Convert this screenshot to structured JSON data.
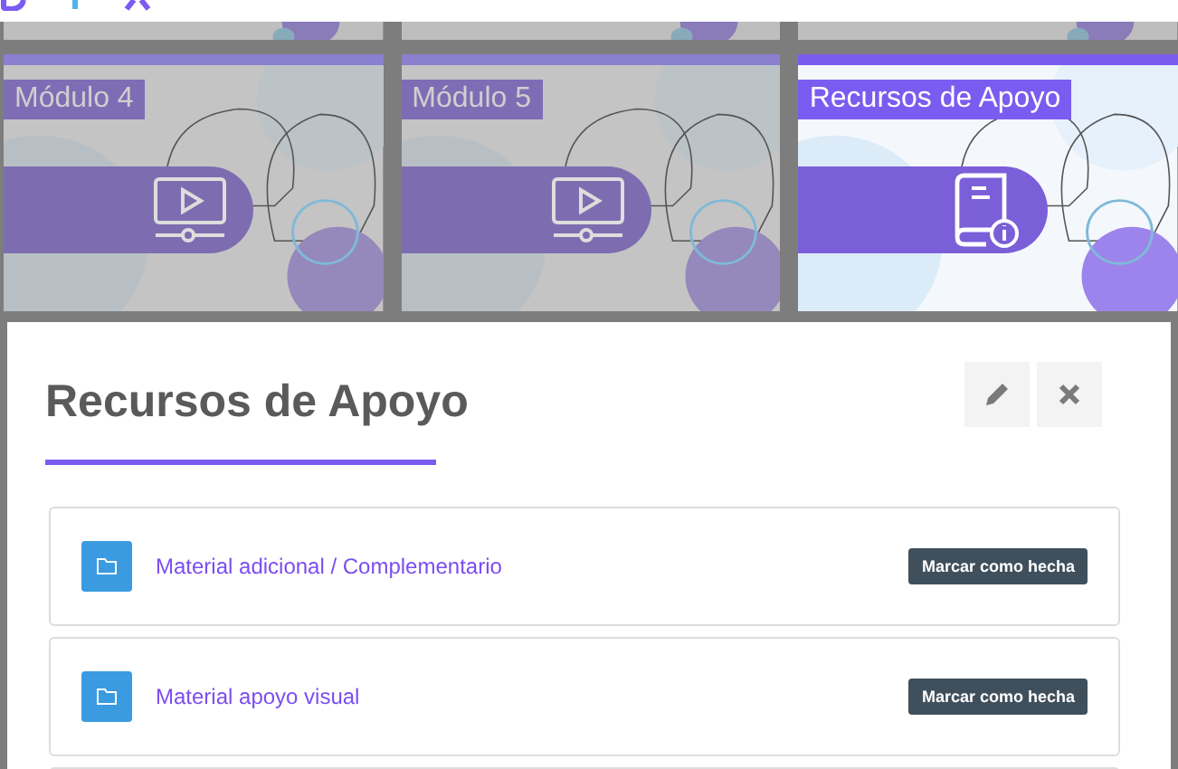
{
  "cards": [
    {
      "label": "Módulo 4",
      "kind": "video",
      "highlighted": false
    },
    {
      "label": "Módulo 5",
      "kind": "video",
      "highlighted": false
    },
    {
      "label": "Recursos de Apoyo",
      "kind": "book",
      "highlighted": true
    }
  ],
  "modal": {
    "title": "Recursos de Apoyo",
    "items": [
      {
        "title": "Material adicional / Complementario",
        "button": "Marcar como hecha"
      },
      {
        "title": "Material apoyo visual",
        "button": "Marcar como hecha"
      }
    ]
  }
}
